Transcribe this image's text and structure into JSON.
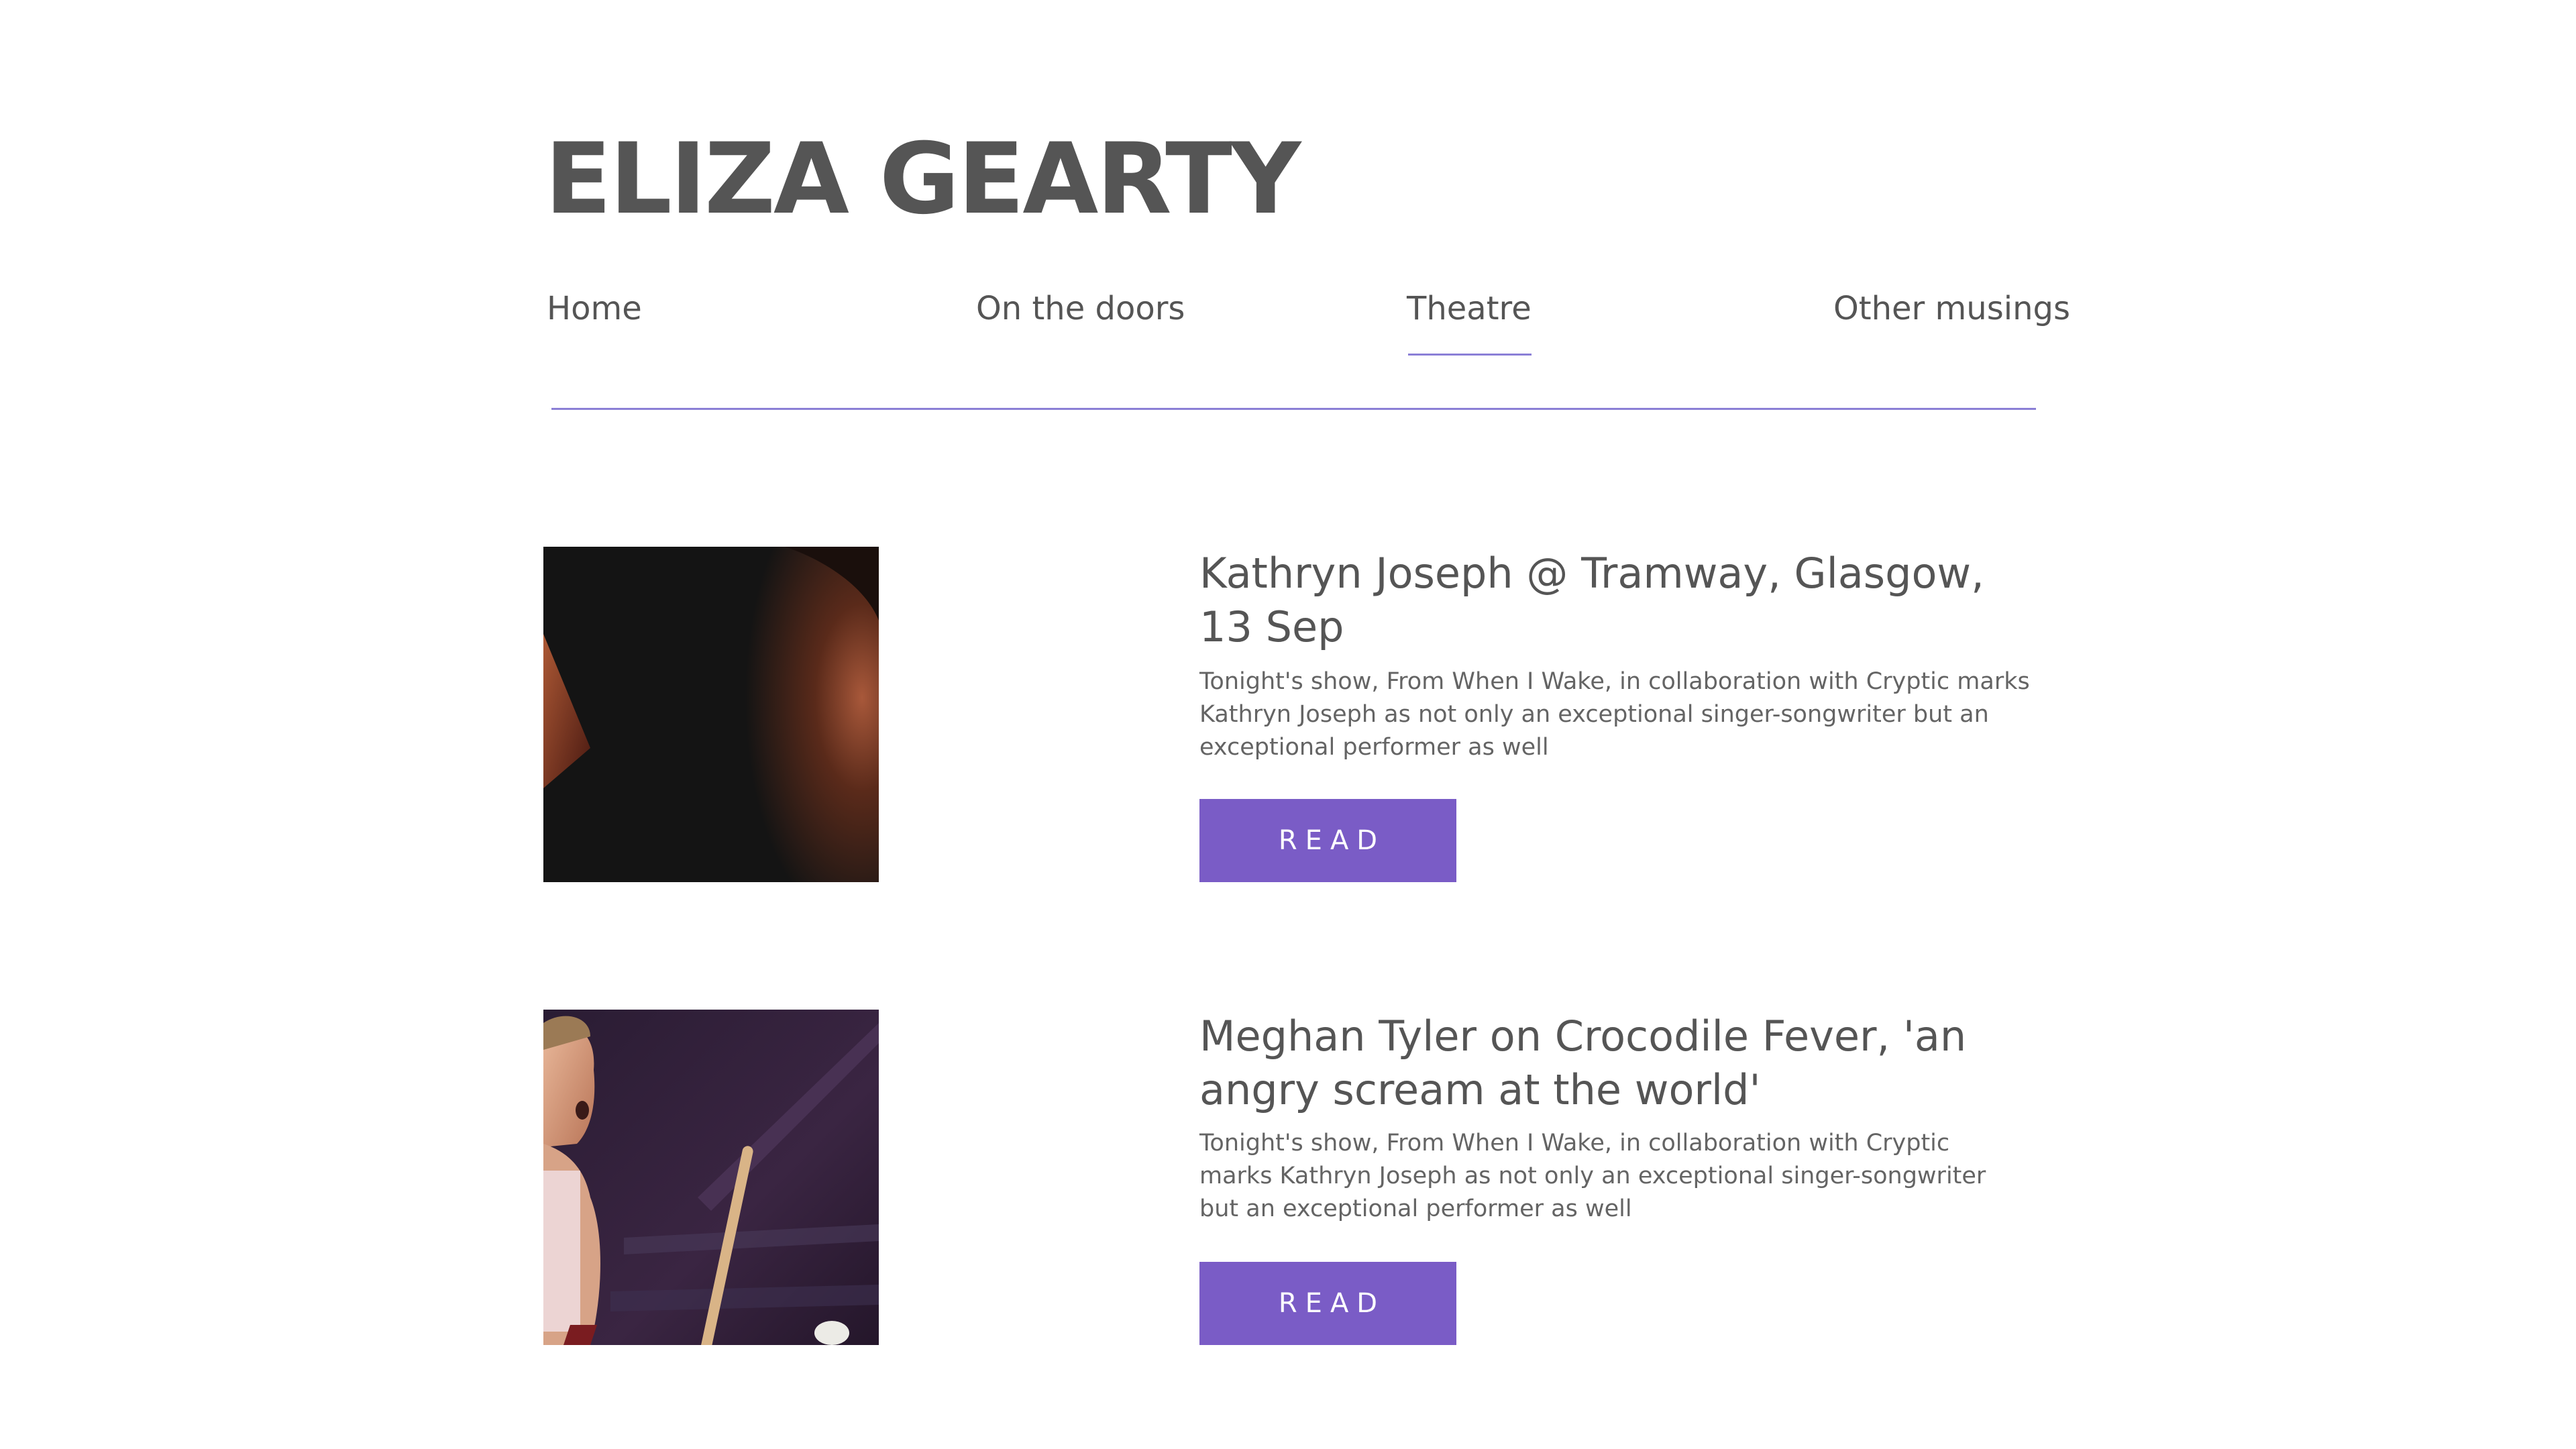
{
  "site": {
    "title": "ELIZA GEARTY"
  },
  "nav": {
    "items": [
      {
        "label": "Home"
      },
      {
        "label": "On the doors"
      },
      {
        "label": "Theatre",
        "active": true
      },
      {
        "label": "Other musings"
      }
    ]
  },
  "posts": [
    {
      "title": "Kathryn Joseph @ Tramway, Glasgow, 13 Sep",
      "excerpt": "Tonight's show, From When I Wake, in collaboration with Cryptic marks Kathryn Joseph as not only an exceptional singer-songwriter but an exceptional performer as well",
      "button_label": "READ",
      "image_desc_icon": "performer-profile-photo"
    },
    {
      "title": "Meghan Tyler on Crocodile Fever, 'an angry scream at the world'",
      "excerpt": "Tonight's show, From When I Wake, in collaboration with Cryptic marks Kathryn Joseph as not only an exceptional singer-songwriter but an exceptional performer as well",
      "button_label": "READ",
      "image_desc_icon": "actress-stage-photo"
    }
  ],
  "colors": {
    "accent": "#7a5cc6",
    "divider": "#8b7fd6",
    "text": "#555555"
  }
}
